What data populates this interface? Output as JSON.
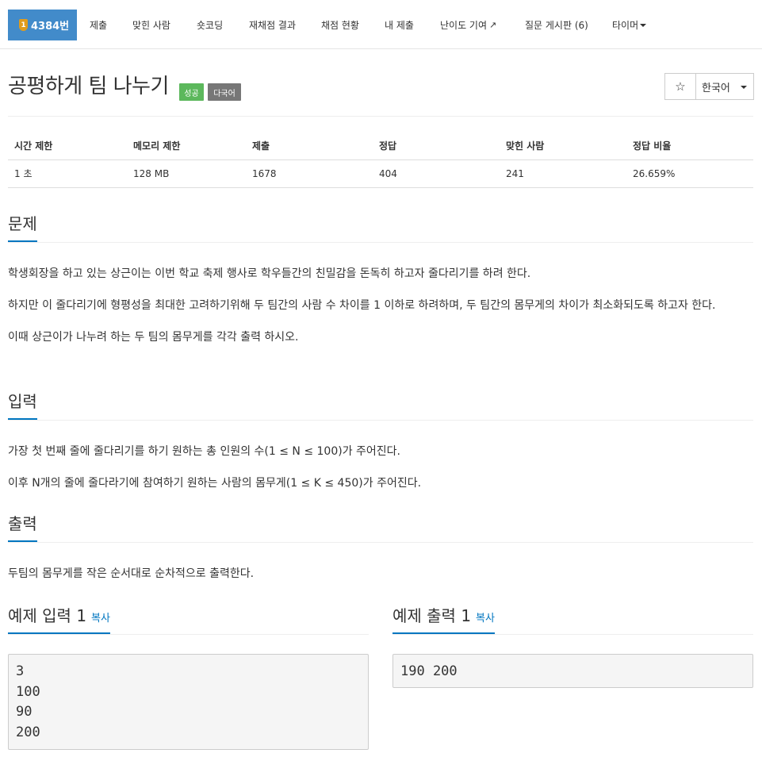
{
  "nav": {
    "problem_tab": {
      "tier": "1",
      "label": "4384번"
    },
    "items": [
      "제출",
      "맞힌 사람",
      "숏코딩",
      "재채점 결과",
      "채점 현황",
      "내 제출",
      "난이도 기여",
      "질문 게시판 (6)",
      "타이머"
    ]
  },
  "problem": {
    "title": "공평하게 팀 나누기",
    "badge_status": "성공",
    "badge_lang": "다국어",
    "star": "☆",
    "language": "한국어"
  },
  "info": {
    "headers": [
      "시간 제한",
      "메모리 제한",
      "제출",
      "정답",
      "맞힌 사람",
      "정답 비율"
    ],
    "values": [
      "1 초",
      "128 MB",
      "1678",
      "404",
      "241",
      "26.659%"
    ]
  },
  "sections": {
    "problem_heading": "문제",
    "problem_lines": [
      "학생회장을 하고 있는 상근이는 이번 학교 축제 행사로 학우들간의 친밀감을 돈독히 하고자 줄다리기를 하려 한다.",
      "하지만 이 줄다리기에 형평성을 최대한 고려하기위해 두 팀간의 사람 수 차이를 1 이하로 하려하며, 두 팀간의 몸무게의 차이가 최소화되도록 하고자 한다.",
      "이때 상근이가 나누려 하는 두 팀의 몸무게를 각각 출력 하시오."
    ],
    "input_heading": "입력",
    "input_lines": [
      "가장 첫 번째 줄에 줄다리기를 하기 원하는 총 인원의 수(1 ≤ N ≤ 100)가 주어진다.",
      "이후 N개의 줄에 줄다라기에 참여하기 원하는 사람의 몸무게(1 ≤ K ≤ 450)가 주어진다."
    ],
    "output_heading": "출력",
    "output_lines": [
      "두팀의 몸무게를 작은 순서대로 순차적으로 출력한다."
    ]
  },
  "samples": {
    "input_title": "예제 입력 1",
    "output_title": "예제 출력 1",
    "copy_label": "복사",
    "input_text": "3\n100\n90\n200",
    "output_text": "190 200"
  }
}
